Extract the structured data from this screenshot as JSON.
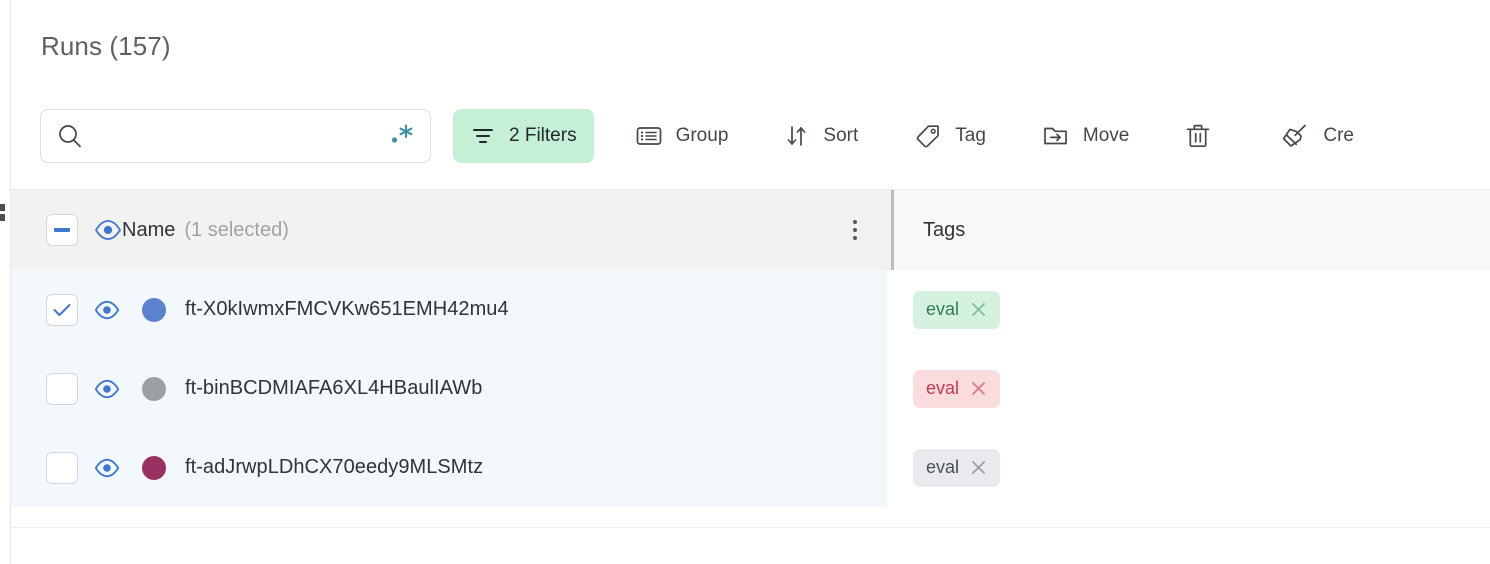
{
  "page": {
    "title": "Runs (157)"
  },
  "search": {
    "value": "",
    "placeholder": "",
    "icon": "search-icon",
    "sparkle_icon": "sparkle-icon",
    "sparkle_color": "#3d8fa5"
  },
  "toolbar": {
    "filters": {
      "label": "2 Filters",
      "icon": "filter-icon",
      "active": true,
      "bg": "#c6f0d6"
    },
    "group": {
      "label": "Group",
      "icon": "list-icon"
    },
    "sort": {
      "label": "Sort",
      "icon": "sort-arrows-icon"
    },
    "tag": {
      "label": "Tag",
      "icon": "tag-icon"
    },
    "move": {
      "label": "Move",
      "icon": "folder-arrow-icon"
    },
    "delete": {
      "label": "",
      "icon": "trash-icon"
    },
    "clean": {
      "label": "Cre",
      "icon": "broom-icon"
    }
  },
  "table": {
    "columns": {
      "name": {
        "label": "Name",
        "sublabel": "(1 selected)",
        "header_checkbox": "indeterminate",
        "eye_icon": "eye-icon",
        "menu_icon": "kebab-menu-icon"
      },
      "tags": {
        "label": "Tags"
      }
    },
    "rows": [
      {
        "checked": true,
        "eye_icon": "eye-icon",
        "dot_color": "#5b82ce",
        "name": "ft-X0kIwmxFMCVKw651EMH42mu4",
        "tags": [
          {
            "label": "eval",
            "bg": "#d5f2e0",
            "fg": "#2f7d53",
            "x_color": "#7cbf99"
          }
        ]
      },
      {
        "checked": false,
        "eye_icon": "eye-icon",
        "dot_color": "#9b9ea3",
        "name": "ft-binBCDMIAFA6XL4HBaulIAWb",
        "tags": [
          {
            "label": "eval",
            "bg": "#fadcdf",
            "fg": "#c23b4e",
            "x_color": "#de7b88"
          }
        ]
      },
      {
        "checked": false,
        "eye_icon": "eye-icon",
        "dot_color": "#993263",
        "name": "ft-adJrwpLDhCX70eedy9MLSMtz",
        "tags": [
          {
            "label": "eval",
            "bg": "#e8eaee",
            "fg": "#4a4e55",
            "x_color": "#9ba0a7"
          }
        ]
      }
    ]
  },
  "colors": {
    "accent_blue": "#3f76cf",
    "header_bg": "#f2f2f1",
    "pinned_row_bg": "#f2f8fc"
  }
}
